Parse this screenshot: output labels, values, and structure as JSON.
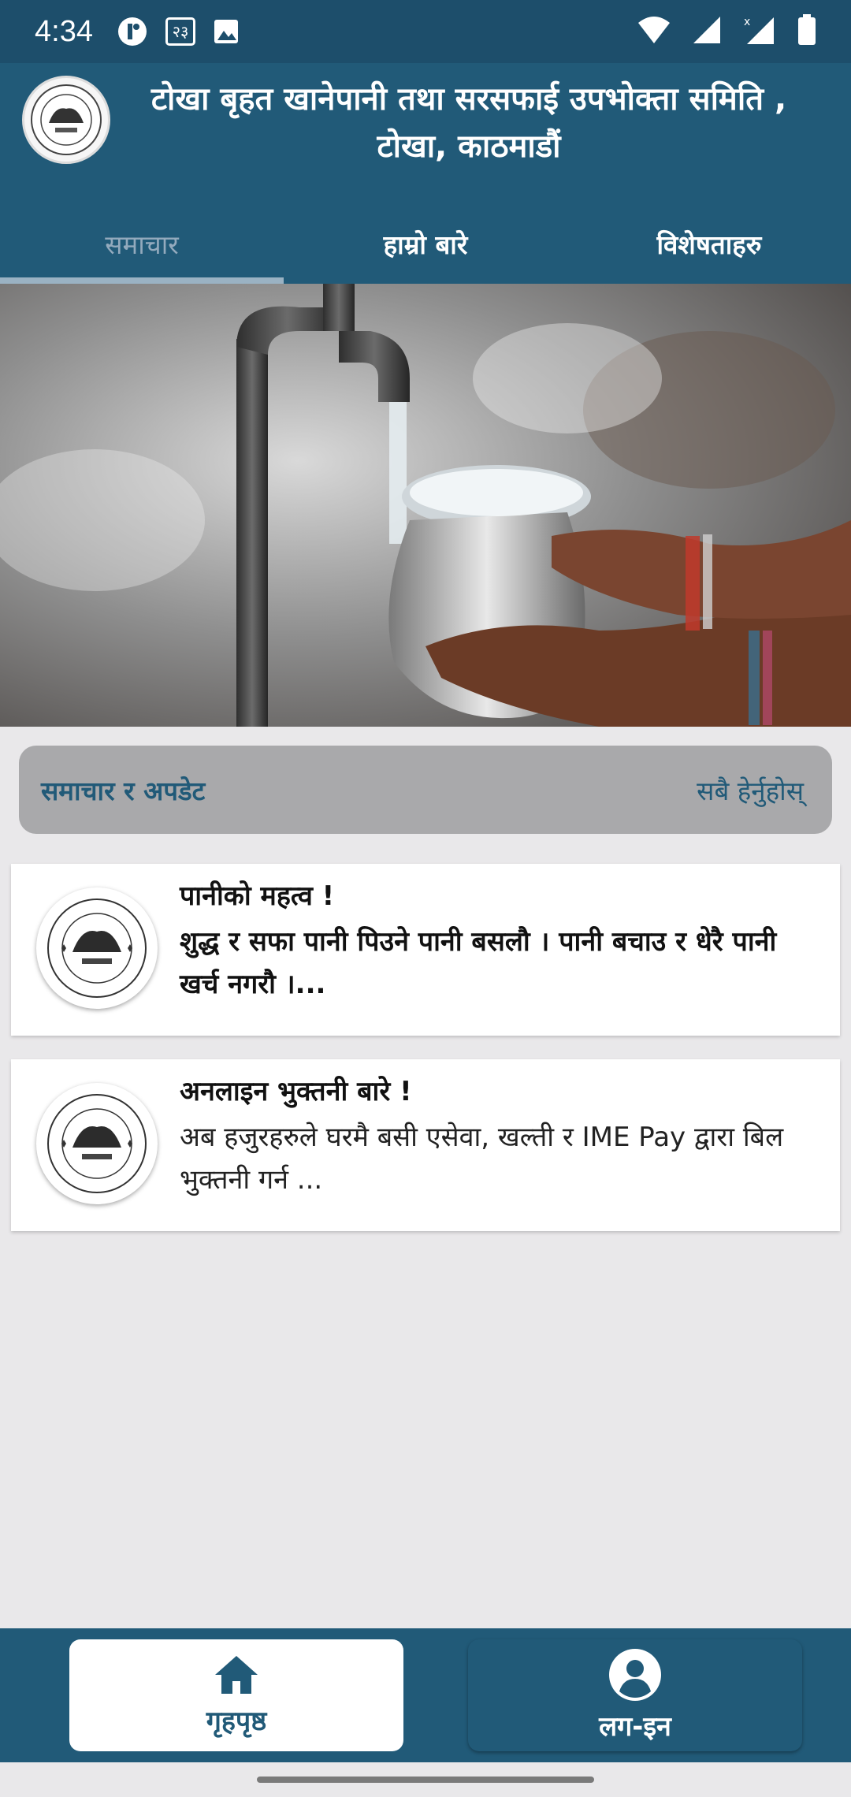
{
  "status_bar": {
    "time": "4:34",
    "icons_left": [
      "circle-app-icon",
      "numeral-chip-icon",
      "image-icon"
    ],
    "numeral_chip": "२३",
    "icons_right": [
      "wifi-icon",
      "signal-icon",
      "signal-x-icon",
      "battery-icon"
    ]
  },
  "header": {
    "title": "टोखा बृहत खानेपानी तथा सरसफाई उपभोक्ता समिति , टोखा, काठमाडौं",
    "logo_icon": "committee-seal-logo"
  },
  "tabs": [
    {
      "label": "समाचार",
      "active": true
    },
    {
      "label": "हाम्रो बारे",
      "active": false
    },
    {
      "label": "विशेषताहरु",
      "active": false
    }
  ],
  "hero": {
    "image": "water-tap-pouring-into-pot"
  },
  "news_section": {
    "title": "समाचार र अपडेट",
    "see_all": "सबै हेर्नुहोस्"
  },
  "news_items": [
    {
      "title": "पानीको महत्व !",
      "body": "शुद्ध र सफा पानी पिउने पानी बसलौ । पानी बचाउ र धेरै पानी खर्च नगरौ ।...",
      "body_bold": true
    },
    {
      "title": "अनलाइन भुक्तनी बारे !",
      "body": "अब हजुरहरुले घरमै बसी एसेवा, खल्ती र IME Pay द्वारा बिल भुक्तनी गर्न ...",
      "body_bold": false
    }
  ],
  "bottom_nav": [
    {
      "label": "गृहपृष्ठ",
      "icon": "home-icon",
      "active": true
    },
    {
      "label": "लग-इन",
      "icon": "account-icon",
      "active": false
    }
  ],
  "colors": {
    "primary": "#215a78",
    "status_bar": "#1d4e6b",
    "background": "#e9e8ea",
    "section_header": "#a9a9ab"
  }
}
